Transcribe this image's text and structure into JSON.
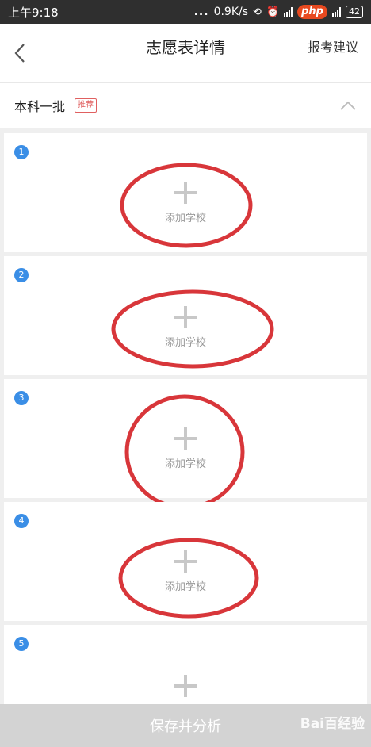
{
  "status_bar": {
    "time": "上午9:18",
    "dots": "...",
    "speed": "0.9K/s",
    "php_badge": "php",
    "battery": "42"
  },
  "header": {
    "title": "志愿表详情",
    "advice_label": "报考建议"
  },
  "batch": {
    "label": "本科一批",
    "badge": "推荐"
  },
  "cards": [
    {
      "number": "1",
      "add_label": "添加学校"
    },
    {
      "number": "2",
      "add_label": "添加学校"
    },
    {
      "number": "3",
      "add_label": "添加学校"
    },
    {
      "number": "4",
      "add_label": "添加学校"
    },
    {
      "number": "5"
    }
  ],
  "footer": {
    "save_label": "保存并分析"
  },
  "watermark": "Bai百经验",
  "colors": {
    "accent_blue": "#3a8ee6",
    "annotation_red": "#d8363a",
    "badge_red": "#e06060"
  }
}
